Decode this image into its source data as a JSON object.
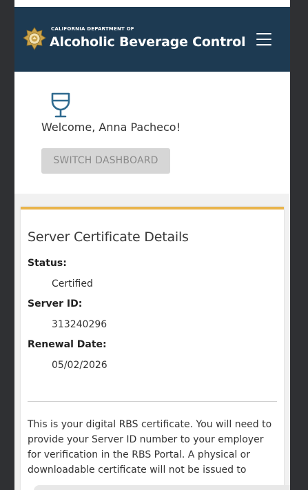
{
  "header": {
    "department": "CALIFORNIA DEPARTMENT OF",
    "agency_name": "Alcoholic Beverage Control",
    "logo_icon": "california-seal-badge-icon",
    "menu_icon": "hamburger-menu-icon",
    "background_color": "#1d3a52"
  },
  "welcome": {
    "icon": "wine-glass-icon",
    "message": "Welcome, Anna Pacheco!",
    "switch_button_label": "SWITCH DASHBOARD"
  },
  "certificate": {
    "title": "Server Certificate Details",
    "accent_color": "#e9b44c",
    "status_label": "Status:",
    "status_value": "Certified",
    "server_id_label": "Server ID:",
    "server_id_value": "313240296",
    "renewal_label": "Renewal Date:",
    "renewal_value": "05/02/2026",
    "notice_text": "This is your digital RBS certificate. You will need to provide your Server ID number to your employer for verification in the RBS Portal. A physical or downloadable certificate will not be issued to"
  }
}
